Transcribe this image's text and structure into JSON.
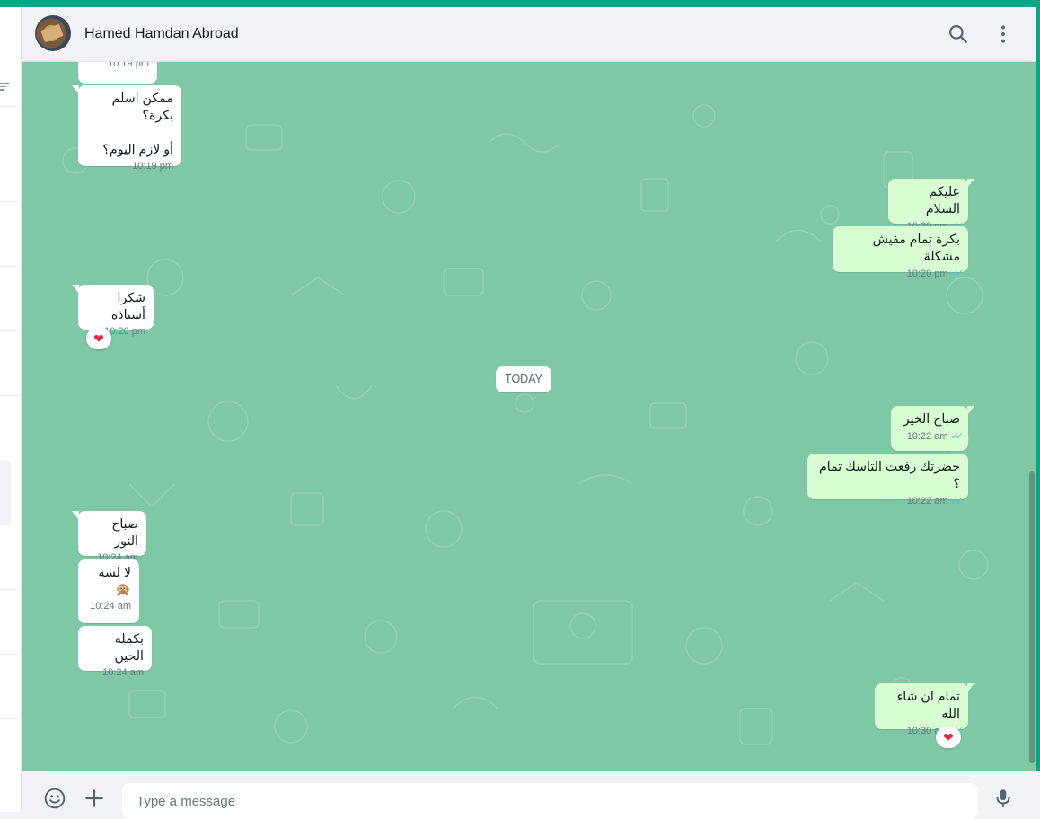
{
  "header": {
    "contact_name": "Hamed Hamdan Abroad"
  },
  "chat": {
    "day_separator": "TODAY",
    "messages": [
      {
        "dir": "in",
        "text": "",
        "time": "10:19 pm"
      },
      {
        "dir": "in",
        "text": "ممكن اسلم بكرة؟\n\nأو لازم اليوم؟",
        "time": "10:19 pm"
      },
      {
        "dir": "out",
        "text": "عليكم السلام",
        "time": "10:20 pm",
        "status": "read"
      },
      {
        "dir": "out",
        "text": "بكرة تمام مفيش مشكلة",
        "time": "10:20 pm",
        "status": "read"
      },
      {
        "dir": "in",
        "text": "شكرا أستاذة",
        "time": "10:20 pm",
        "reaction": "❤"
      },
      {
        "dir": "out",
        "text": "صباح الخير",
        "time": "10:22 am",
        "status": "read"
      },
      {
        "dir": "out",
        "text": "حضرتك رفعت التاسك تمام ؟",
        "time": "10:22 am",
        "status": "read"
      },
      {
        "dir": "in",
        "text": "صباح النور",
        "time": "10:24 am"
      },
      {
        "dir": "in",
        "text": "لا لسه\n🙊",
        "time": "10:24 am"
      },
      {
        "dir": "in",
        "text": "بكمله الحين",
        "time": "10:24 am"
      },
      {
        "dir": "out",
        "text": "تمام ان شاء الله",
        "time": "10:30 am",
        "status": "read",
        "reaction": "❤"
      }
    ]
  },
  "composer": {
    "placeholder": "Type a message"
  },
  "icons": {
    "search": "search-icon",
    "menu": "kebab-menu-icon",
    "emoji": "emoji-icon",
    "attach": "plus-icon",
    "mic": "microphone-icon"
  },
  "colors": {
    "brand": "#00a884",
    "chat_bg": "#7ec8a5",
    "outgoing_bubble": "#d9fdd3",
    "incoming_bubble": "#ffffff",
    "read_ticks": "#53bdeb",
    "reaction_heart": "#e8254a"
  }
}
